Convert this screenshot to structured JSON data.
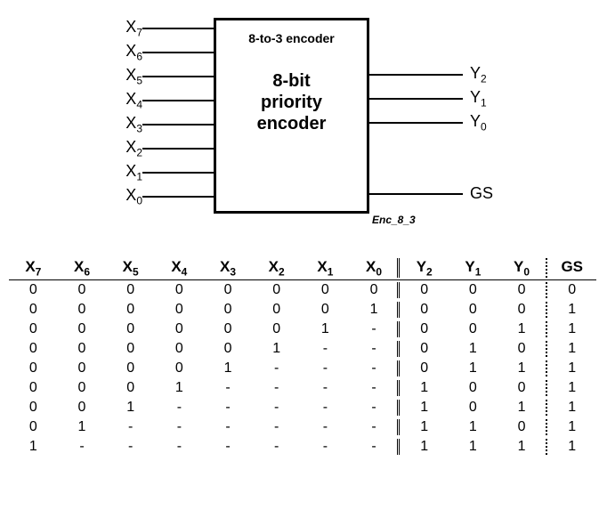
{
  "diagram": {
    "title": "8-to-3 encoder",
    "subtitle_line1": "8-bit",
    "subtitle_line2": "priority",
    "subtitle_line3": "encoder",
    "entity_label": "Enc_8_3",
    "inputs": [
      "X",
      "X",
      "X",
      "X",
      "X",
      "X",
      "X",
      "X"
    ],
    "input_subs": [
      "7",
      "6",
      "5",
      "4",
      "3",
      "2",
      "1",
      "0"
    ],
    "outputs_y": [
      "Y",
      "Y",
      "Y"
    ],
    "output_y_subs": [
      "2",
      "1",
      "0"
    ],
    "output_gs": "GS"
  },
  "truth_table": {
    "headers_in": [
      {
        "base": "X",
        "sub": "7"
      },
      {
        "base": "X",
        "sub": "6"
      },
      {
        "base": "X",
        "sub": "5"
      },
      {
        "base": "X",
        "sub": "4"
      },
      {
        "base": "X",
        "sub": "3"
      },
      {
        "base": "X",
        "sub": "2"
      },
      {
        "base": "X",
        "sub": "1"
      },
      {
        "base": "X",
        "sub": "0"
      }
    ],
    "headers_out_y": [
      {
        "base": "Y",
        "sub": "2"
      },
      {
        "base": "Y",
        "sub": "1"
      },
      {
        "base": "Y",
        "sub": "0"
      }
    ],
    "header_gs": "GS",
    "rows": [
      {
        "in": [
          "0",
          "0",
          "0",
          "0",
          "0",
          "0",
          "0",
          "0"
        ],
        "y": [
          "0",
          "0",
          "0"
        ],
        "gs": "0"
      },
      {
        "in": [
          "0",
          "0",
          "0",
          "0",
          "0",
          "0",
          "0",
          "1"
        ],
        "y": [
          "0",
          "0",
          "0"
        ],
        "gs": "1"
      },
      {
        "in": [
          "0",
          "0",
          "0",
          "0",
          "0",
          "0",
          "1",
          "-"
        ],
        "y": [
          "0",
          "0",
          "1"
        ],
        "gs": "1"
      },
      {
        "in": [
          "0",
          "0",
          "0",
          "0",
          "0",
          "1",
          "-",
          "-"
        ],
        "y": [
          "0",
          "1",
          "0"
        ],
        "gs": "1"
      },
      {
        "in": [
          "0",
          "0",
          "0",
          "0",
          "1",
          "-",
          "-",
          "-"
        ],
        "y": [
          "0",
          "1",
          "1"
        ],
        "gs": "1"
      },
      {
        "in": [
          "0",
          "0",
          "0",
          "1",
          "-",
          "-",
          "-",
          "-"
        ],
        "y": [
          "1",
          "0",
          "0"
        ],
        "gs": "1"
      },
      {
        "in": [
          "0",
          "0",
          "1",
          "-",
          "-",
          "-",
          "-",
          "-"
        ],
        "y": [
          "1",
          "0",
          "1"
        ],
        "gs": "1"
      },
      {
        "in": [
          "0",
          "1",
          "-",
          "-",
          "-",
          "-",
          "-",
          "-"
        ],
        "y": [
          "1",
          "1",
          "0"
        ],
        "gs": "1"
      },
      {
        "in": [
          "1",
          "-",
          "-",
          "-",
          "-",
          "-",
          "-",
          "-"
        ],
        "y": [
          "1",
          "1",
          "1"
        ],
        "gs": "1"
      }
    ]
  },
  "chart_data": {
    "type": "table",
    "description": "8-to-3 priority encoder truth table",
    "inputs": [
      "X7",
      "X6",
      "X5",
      "X4",
      "X3",
      "X2",
      "X1",
      "X0"
    ],
    "outputs": [
      "Y2",
      "Y1",
      "Y0",
      "GS"
    ],
    "rows": [
      [
        "0",
        "0",
        "0",
        "0",
        "0",
        "0",
        "0",
        "0",
        "0",
        "0",
        "0",
        "0"
      ],
      [
        "0",
        "0",
        "0",
        "0",
        "0",
        "0",
        "0",
        "1",
        "0",
        "0",
        "0",
        "1"
      ],
      [
        "0",
        "0",
        "0",
        "0",
        "0",
        "0",
        "1",
        "-",
        "0",
        "0",
        "1",
        "1"
      ],
      [
        "0",
        "0",
        "0",
        "0",
        "0",
        "1",
        "-",
        "-",
        "0",
        "1",
        "0",
        "1"
      ],
      [
        "0",
        "0",
        "0",
        "0",
        "1",
        "-",
        "-",
        "-",
        "0",
        "1",
        "1",
        "1"
      ],
      [
        "0",
        "0",
        "0",
        "1",
        "-",
        "-",
        "-",
        "-",
        "1",
        "0",
        "0",
        "1"
      ],
      [
        "0",
        "0",
        "1",
        "-",
        "-",
        "-",
        "-",
        "-",
        "1",
        "0",
        "1",
        "1"
      ],
      [
        "0",
        "1",
        "-",
        "-",
        "-",
        "-",
        "-",
        "-",
        "1",
        "1",
        "0",
        "1"
      ],
      [
        "1",
        "-",
        "-",
        "-",
        "-",
        "-",
        "-",
        "-",
        "1",
        "1",
        "1",
        "1"
      ]
    ]
  }
}
